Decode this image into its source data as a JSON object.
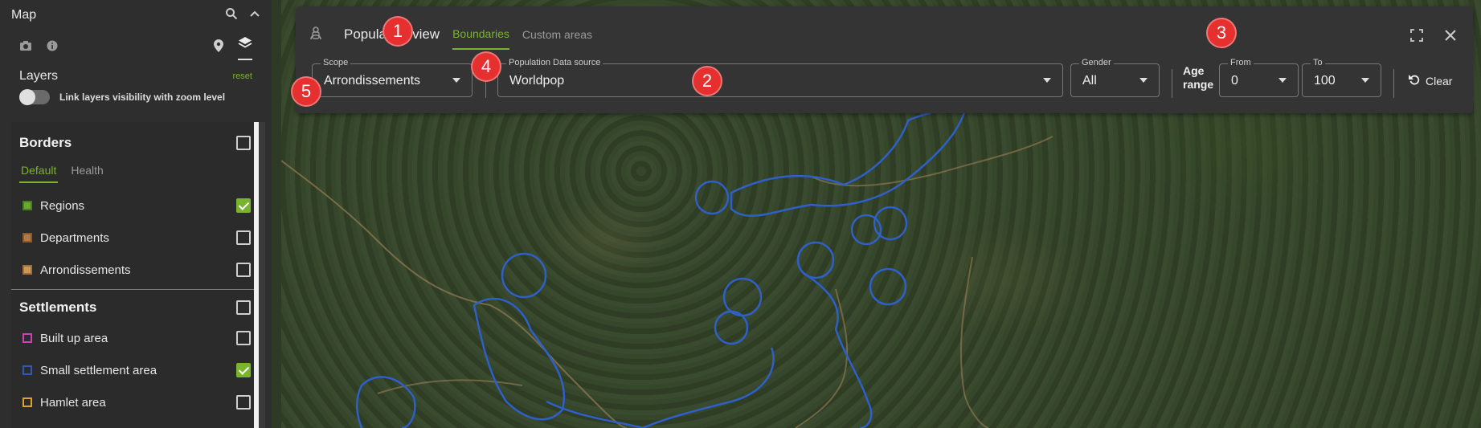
{
  "sidebar": {
    "title": "Map",
    "head_icons": [
      "search-icon",
      "chevron-up-icon"
    ],
    "tool_icons": [
      "camera-icon",
      "info-icon",
      "pin-icon",
      "layers-icon"
    ],
    "layers_label": "Layers",
    "reset_label": "reset",
    "link_label": "Link layers visibility with zoom level",
    "borders": {
      "title": "Borders",
      "checked": false,
      "tabs": [
        "Default",
        "Health"
      ],
      "active_tab": "Default",
      "items": [
        {
          "label": "Regions",
          "checked": true,
          "color": "#6aa832"
        },
        {
          "label": "Departments",
          "checked": false,
          "color": "#b07a48"
        },
        {
          "label": "Arrondissements",
          "checked": false,
          "color": "#c89858"
        }
      ]
    },
    "settlements": {
      "title": "Settlements",
      "checked": false,
      "items": [
        {
          "label": "Built up area",
          "checked": false,
          "color": "#d03fb5"
        },
        {
          "label": "Small settlement area",
          "checked": true,
          "color": "#2f58b8"
        },
        {
          "label": "Hamlet area",
          "checked": false,
          "color": "#e0a02a"
        }
      ]
    }
  },
  "overlay": {
    "title": "Population view",
    "tabs": [
      "Boundaries",
      "Custom areas"
    ],
    "active_tab": "Boundaries",
    "scope": {
      "label": "Scope",
      "value": "Arrondissements"
    },
    "source": {
      "label": "Population Data source",
      "value": "Worldpop"
    },
    "gender": {
      "label": "Gender",
      "value": "All"
    },
    "age_range": {
      "label_line1": "Age",
      "label_line2": "range"
    },
    "from": {
      "label": "From",
      "value": "0"
    },
    "to": {
      "label": "To",
      "value": "100"
    },
    "clear_label": "Clear"
  },
  "markers": [
    "1",
    "2",
    "3",
    "4",
    "5"
  ],
  "colors": {
    "accent": "#7ab32e",
    "marker": "#e5302f",
    "boundary": "#2f5fc8"
  }
}
